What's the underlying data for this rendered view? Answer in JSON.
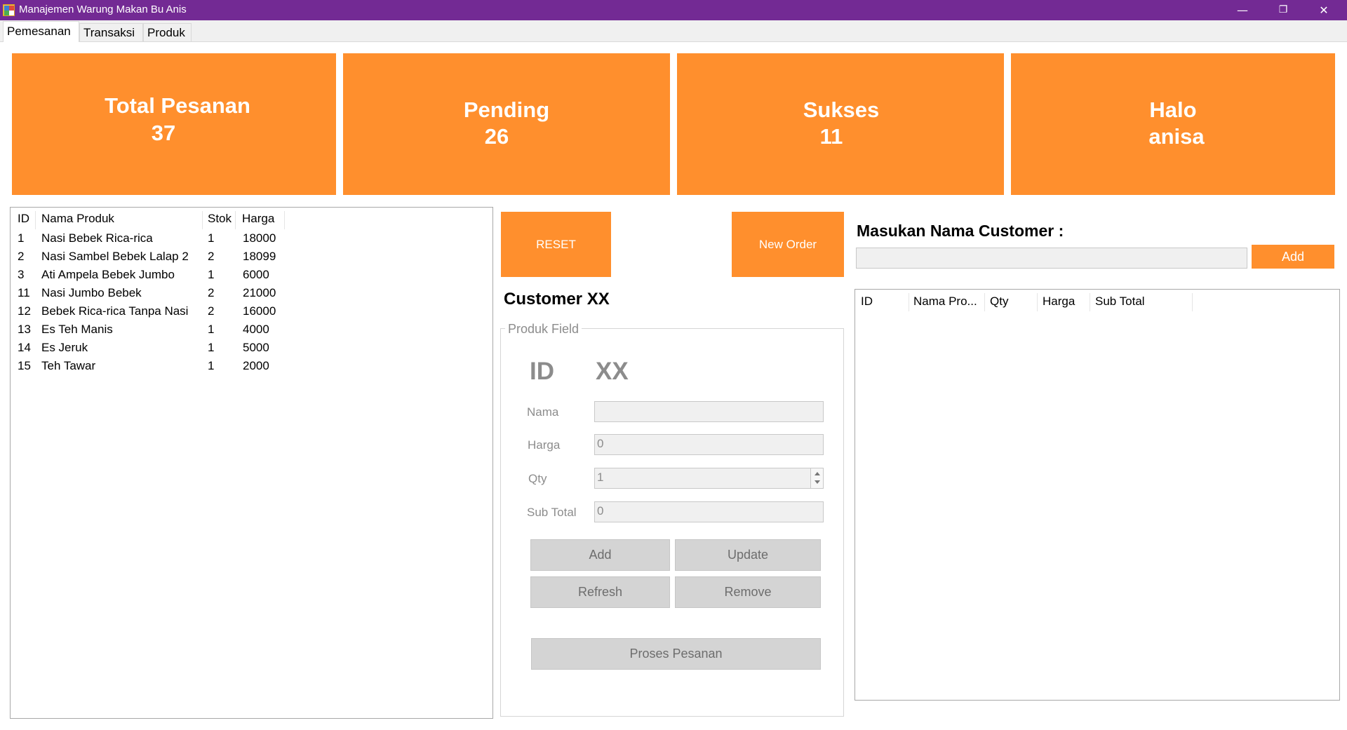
{
  "window": {
    "title": "Manajemen Warung Makan Bu Anis",
    "minimize": "—",
    "restore": "❐",
    "close": "✕"
  },
  "tabs": [
    {
      "label": "Pemesanan",
      "active": true
    },
    {
      "label": "Transaksi",
      "active": false
    },
    {
      "label": "Produk",
      "active": false
    }
  ],
  "stats": {
    "total_label": "Total Pesanan",
    "total_value": "37",
    "pending_label": "Pending",
    "pending_value": "26",
    "sukses_label": "Sukses",
    "sukses_value": "11",
    "halo_label": "Halo",
    "halo_user": "anisa"
  },
  "products": {
    "headers": [
      "ID",
      "Nama Produk",
      "Stok",
      "Harga"
    ],
    "rows": [
      [
        "1",
        "Nasi Bebek Rica-rica",
        "1",
        "18000"
      ],
      [
        "2",
        "Nasi Sambel Bebek Lalap 2",
        "2",
        "18099"
      ],
      [
        "3",
        "Ati Ampela Bebek Jumbo",
        "1",
        "6000"
      ],
      [
        "11",
        "Nasi Jumbo Bebek",
        "2",
        "21000"
      ],
      [
        "12",
        "Bebek Rica-rica Tanpa Nasi",
        "2",
        "16000"
      ],
      [
        "13",
        "Es Teh Manis",
        "1",
        "4000"
      ],
      [
        "14",
        "Es Jeruk",
        "1",
        "5000"
      ],
      [
        "15",
        "Teh Tawar",
        "1",
        "2000"
      ]
    ]
  },
  "actions": {
    "reset": "RESET",
    "new_order": "New Order"
  },
  "customer": {
    "heading": "Customer XX",
    "prompt": "Masukan Nama Customer :",
    "name_value": "",
    "add": "Add"
  },
  "produk_field": {
    "group_label": "Produk Field",
    "id_label": "ID",
    "id_value": "XX",
    "nama_label": "Nama",
    "nama_value": "",
    "harga_label": "Harga",
    "harga_value": "0",
    "qty_label": "Qty",
    "qty_value": "1",
    "subtotal_label": "Sub Total",
    "subtotal_value": "0",
    "add": "Add",
    "update": "Update",
    "refresh": "Refresh",
    "remove": "Remove",
    "proses": "Proses Pesanan"
  },
  "order_list": {
    "headers": [
      "ID",
      "Nama Pro...",
      "Qty",
      "Harga",
      "Sub Total"
    ],
    "rows": []
  }
}
